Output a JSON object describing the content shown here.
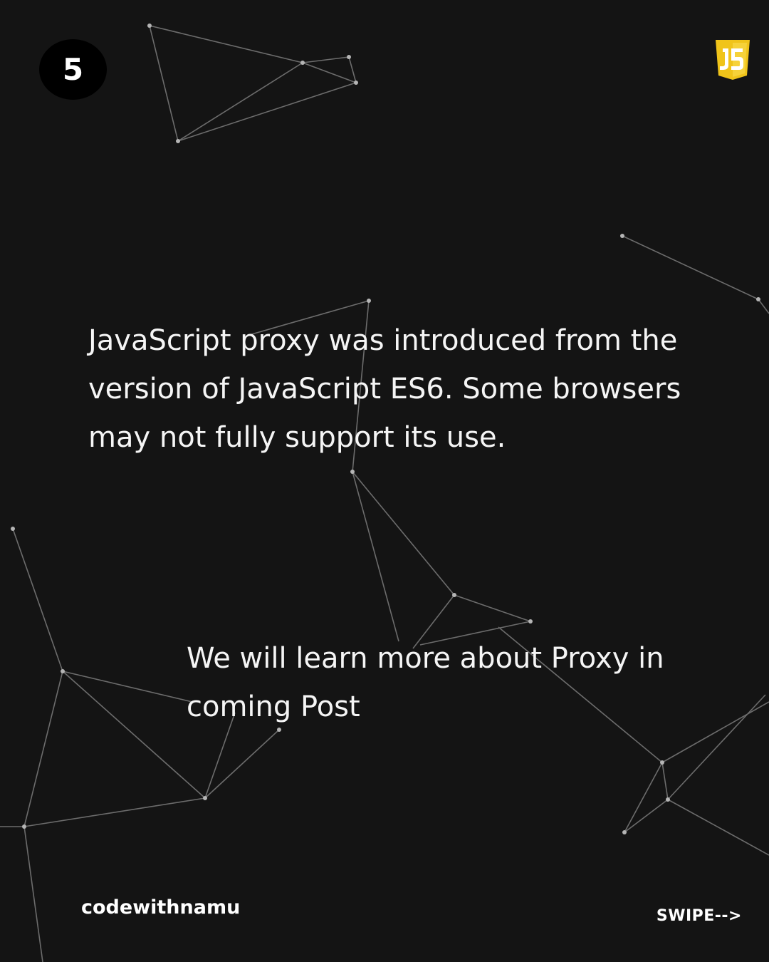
{
  "header": {
    "page_number": "5",
    "logo_icon": "javascript-logo-icon",
    "logo_text": "JS"
  },
  "content": {
    "main_text": "JavaScript proxy was introduced from the version of JavaScript ES6. Some browsers may not fully support its use.",
    "secondary_text": "We will learn more about Proxy in coming Post"
  },
  "footer": {
    "handle": "codewithnamu",
    "swipe": "SWIPE-->"
  },
  "colors": {
    "background": "#141414",
    "text": "#f5f5f5",
    "logo_yellow": "#f0c41a",
    "network_lines": "#8a8a8a"
  }
}
